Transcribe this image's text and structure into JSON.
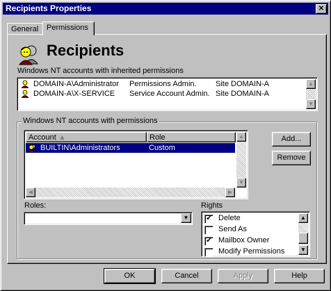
{
  "window": {
    "title": "Recipients Properties",
    "close_glyph": "✕"
  },
  "tabs": [
    {
      "label": "General"
    },
    {
      "label": "Permissions"
    }
  ],
  "header": {
    "title": "Recipients",
    "icon": "people-icon"
  },
  "inherited": {
    "label": "Windows NT accounts with inherited permissions",
    "rows": [
      {
        "account": "DOMAIN-A\\Administrator",
        "role": "Permissions Admin.",
        "scope": "Site DOMAIN-A"
      },
      {
        "account": "DOMAIN-A\\X-SERVICE",
        "role": "Service Account Admin.",
        "scope": "Site DOMAIN-A"
      }
    ]
  },
  "permissions_group": {
    "label": "Windows NT accounts with permissions",
    "columns": {
      "account": "Account",
      "role": "Role"
    },
    "rows": [
      {
        "account": "BUILTIN\\Administrators",
        "role": "Custom",
        "selected": true
      }
    ],
    "add_label": "Add...",
    "remove_label": "Remove"
  },
  "roles": {
    "label": "Roles:",
    "value": ""
  },
  "rights": {
    "label": "Rights",
    "items": [
      {
        "label": "Delete",
        "checked": true
      },
      {
        "label": "Send As",
        "checked": false
      },
      {
        "label": "Mailbox Owner",
        "checked": true
      },
      {
        "label": "Modify Permissions",
        "checked": false
      }
    ]
  },
  "footer": {
    "ok": "OK",
    "cancel": "Cancel",
    "apply": "Apply",
    "help": "Help"
  },
  "colors": {
    "titlebar": "#000080",
    "selection": "#000080",
    "face": "#c0c0c0"
  }
}
